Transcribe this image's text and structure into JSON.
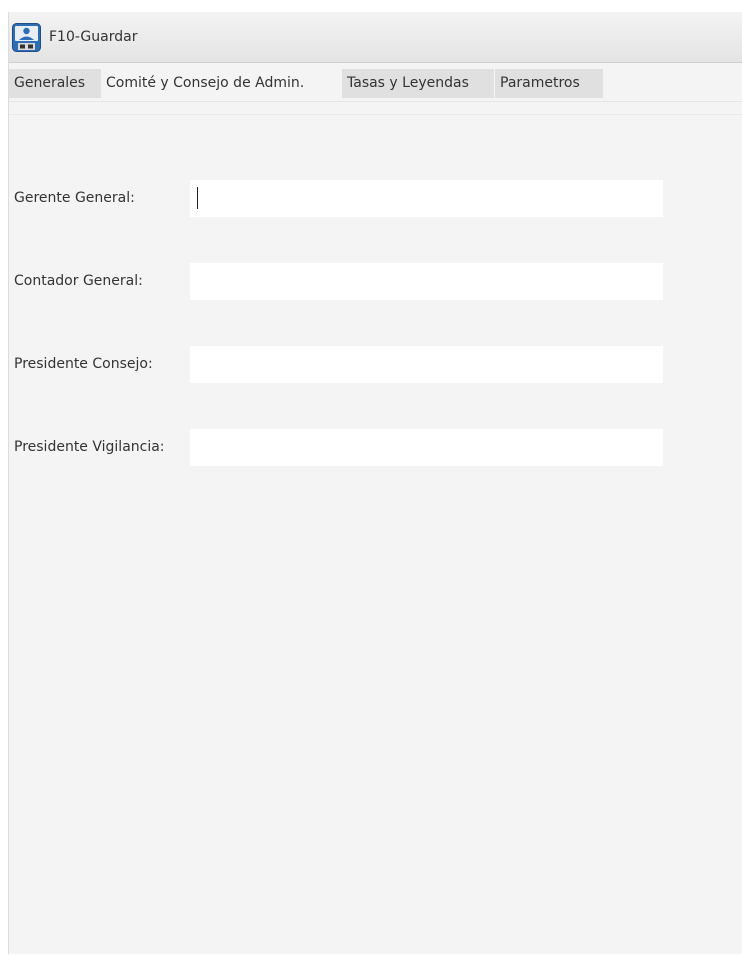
{
  "toolbar": {
    "save_label": "F10-Guardar",
    "save_icon": "save-disk-icon"
  },
  "tabs": [
    {
      "label": "Generales",
      "active": false
    },
    {
      "label": "Comité y Consejo de Admin.",
      "active": true
    },
    {
      "label": "Tasas y Leyendas",
      "active": false
    },
    {
      "label": "Parametros",
      "active": false
    }
  ],
  "form": {
    "fields": [
      {
        "label": "Gerente General:",
        "value": "",
        "focused": true
      },
      {
        "label": "Contador General:",
        "value": ""
      },
      {
        "label": "Presidente Consejo:",
        "value": ""
      },
      {
        "label": "Presidente Vigilancia:",
        "value": ""
      }
    ]
  },
  "colors": {
    "panel_bg": "#f4f4f4",
    "inactive_tab_bg": "#e0e0e0",
    "input_bg": "#ffffff",
    "text": "#333333"
  }
}
